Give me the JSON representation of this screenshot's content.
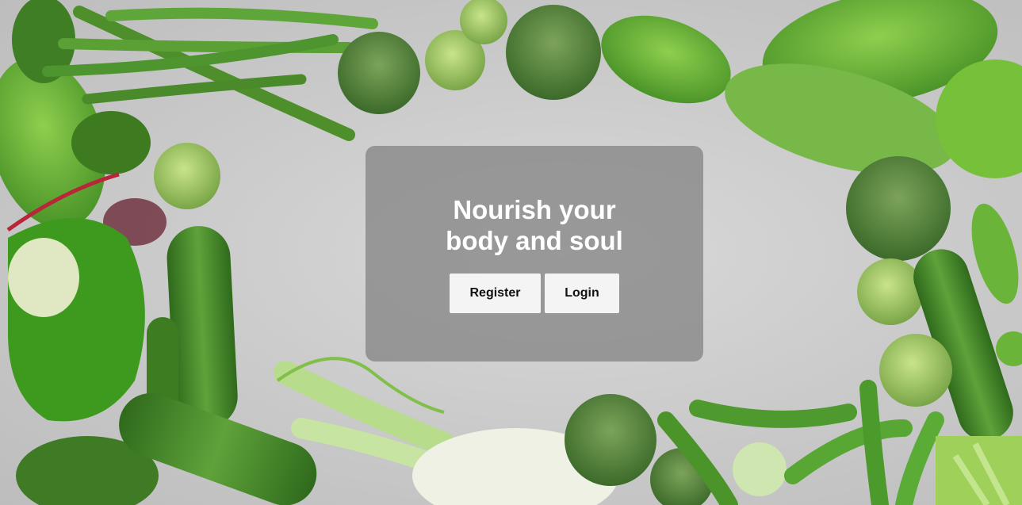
{
  "hero": {
    "title_line1": "Nourish your",
    "title_line2": "body and soul"
  },
  "actions": {
    "register_label": "Register",
    "login_label": "Login"
  },
  "colors": {
    "card_overlay": "#808080",
    "button_bg": "#f4f4f4",
    "title_color": "#ffffff",
    "veg_green": "#4f9a2a",
    "background_stone": "#cfcfcf"
  },
  "background": {
    "image_subject": "green-vegetables-frame"
  }
}
